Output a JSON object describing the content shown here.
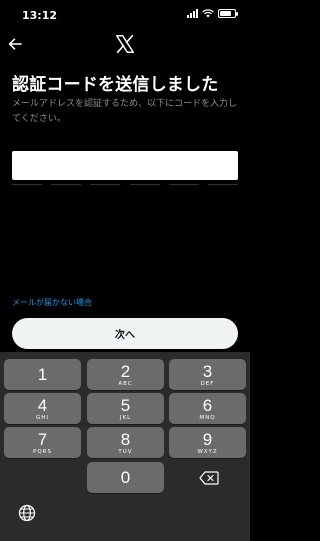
{
  "status_bar": {
    "time": "13:12"
  },
  "header": {
    "back_icon": "arrow-left-icon",
    "logo_icon": "x-logo-icon"
  },
  "main": {
    "title": "認証コードを送信しました",
    "description": "メールアドレスを認証するため、以下にコードを入力してください。",
    "code_value": "",
    "code_length": 6,
    "no_email_link": "メールが届かない場合",
    "next_label": "次へ"
  },
  "keyboard": {
    "keys": [
      {
        "num": "1",
        "letters": ""
      },
      {
        "num": "2",
        "letters": "ABC"
      },
      {
        "num": "3",
        "letters": "DEF"
      },
      {
        "num": "4",
        "letters": "GHI"
      },
      {
        "num": "5",
        "letters": "JKL"
      },
      {
        "num": "6",
        "letters": "MNO"
      },
      {
        "num": "7",
        "letters": "PQRS"
      },
      {
        "num": "8",
        "letters": "TUV"
      },
      {
        "num": "9",
        "letters": "WXYZ"
      },
      {
        "num": "0",
        "letters": ""
      }
    ],
    "delete_icon": "backspace-icon",
    "globe_icon": "globe-icon"
  },
  "colors": {
    "link": "#1d9bf0",
    "key": "#6b6b6b",
    "keyboard_bg": "#2b2b2b",
    "button_bg": "#eff3f4"
  }
}
